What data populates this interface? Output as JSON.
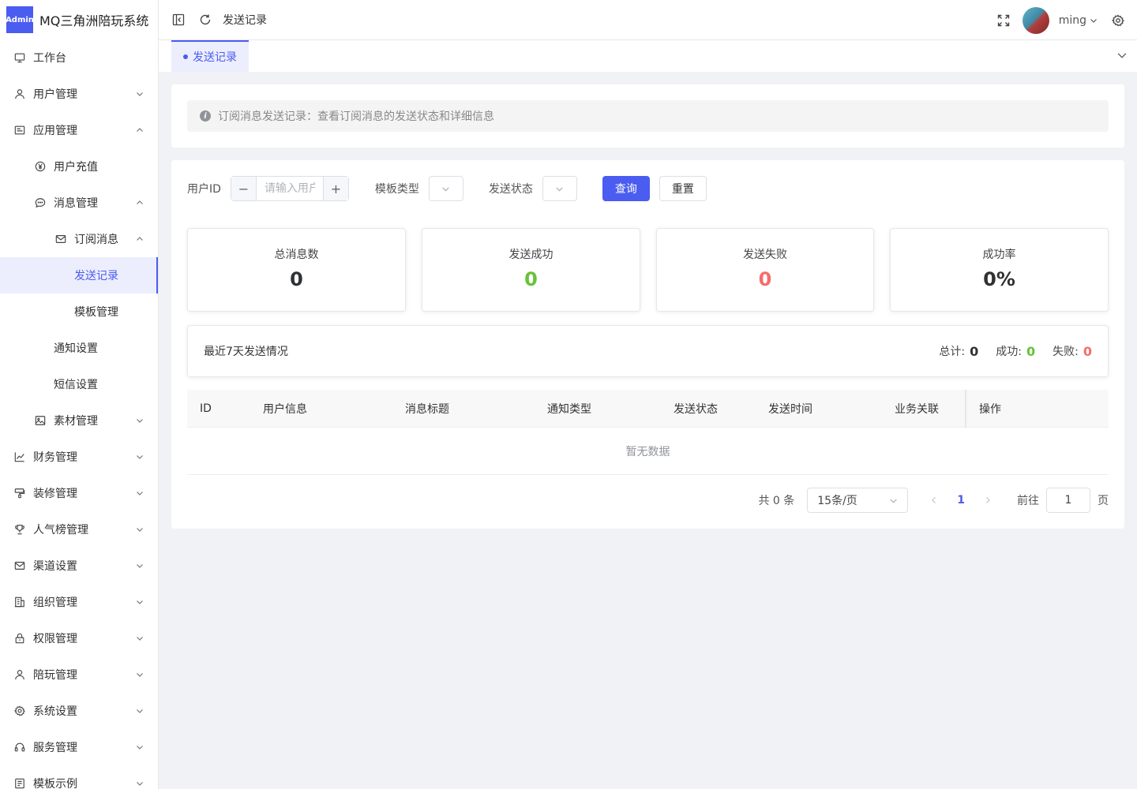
{
  "app": {
    "logo_badge": "Admin",
    "title": "MQ三角洲陪玩系统"
  },
  "sidebar": {
    "items": [
      {
        "label": "工作台",
        "icon": "monitor-icon"
      },
      {
        "label": "用户管理",
        "icon": "user-icon"
      },
      {
        "label": "应用管理",
        "icon": "app-icon"
      },
      {
        "label": "用户充值",
        "icon": "yen-icon"
      },
      {
        "label": "消息管理",
        "icon": "chat-icon"
      },
      {
        "label": "订阅消息",
        "icon": "mail-icon"
      },
      {
        "label": "发送记录"
      },
      {
        "label": "模板管理"
      },
      {
        "label": "通知设置"
      },
      {
        "label": "短信设置"
      },
      {
        "label": "素材管理",
        "icon": "image-icon"
      },
      {
        "label": "财务管理",
        "icon": "chart-icon"
      },
      {
        "label": "装修管理",
        "icon": "brush-icon"
      },
      {
        "label": "人气榜管理",
        "icon": "trophy-icon"
      },
      {
        "label": "渠道设置",
        "icon": "mail-icon"
      },
      {
        "label": "组织管理",
        "icon": "building-icon"
      },
      {
        "label": "权限管理",
        "icon": "lock-icon"
      },
      {
        "label": "陪玩管理",
        "icon": "user-icon"
      },
      {
        "label": "系统设置",
        "icon": "gear-icon"
      },
      {
        "label": "服务管理",
        "icon": "headset-icon"
      },
      {
        "label": "模板示例",
        "icon": "template-icon"
      }
    ]
  },
  "header": {
    "breadcrumb": "发送记录",
    "username": "ming"
  },
  "tabs": [
    {
      "label": "发送记录"
    }
  ],
  "alert": {
    "text": "订阅消息发送记录：查看订阅消息的发送状态和详细信息"
  },
  "filters": {
    "user_id_label": "用户ID",
    "user_id_placeholder": "请输入用户",
    "template_type_label": "模板类型",
    "send_status_label": "发送状态",
    "query_button": "查询",
    "reset_button": "重置"
  },
  "stats": [
    {
      "label": "总消息数",
      "value": "0",
      "color": "#303133"
    },
    {
      "label": "发送成功",
      "value": "0",
      "color": "#67c23a"
    },
    {
      "label": "发送失败",
      "value": "0",
      "color": "#f56c6c"
    },
    {
      "label": "成功率",
      "value": "0%",
      "color": "#303133"
    }
  ],
  "week": {
    "title": "最近7天发送情况",
    "total_label": "总计:",
    "total_value": "0",
    "success_label": "成功:",
    "success_value": "0",
    "fail_label": "失败:",
    "fail_value": "0"
  },
  "table": {
    "columns": [
      "ID",
      "用户信息",
      "消息标题",
      "通知类型",
      "发送状态",
      "发送时间",
      "业务关联",
      "操作"
    ],
    "empty_text": "暂无数据"
  },
  "pagination": {
    "total_text": "共 0 条",
    "page_size": "15条/页",
    "current_page": "1",
    "goto_label": "前往",
    "goto_value": "1",
    "page_suffix": "页"
  },
  "colors": {
    "accent": "#4b5cf0",
    "success": "#67c23a",
    "danger": "#f56c6c"
  }
}
